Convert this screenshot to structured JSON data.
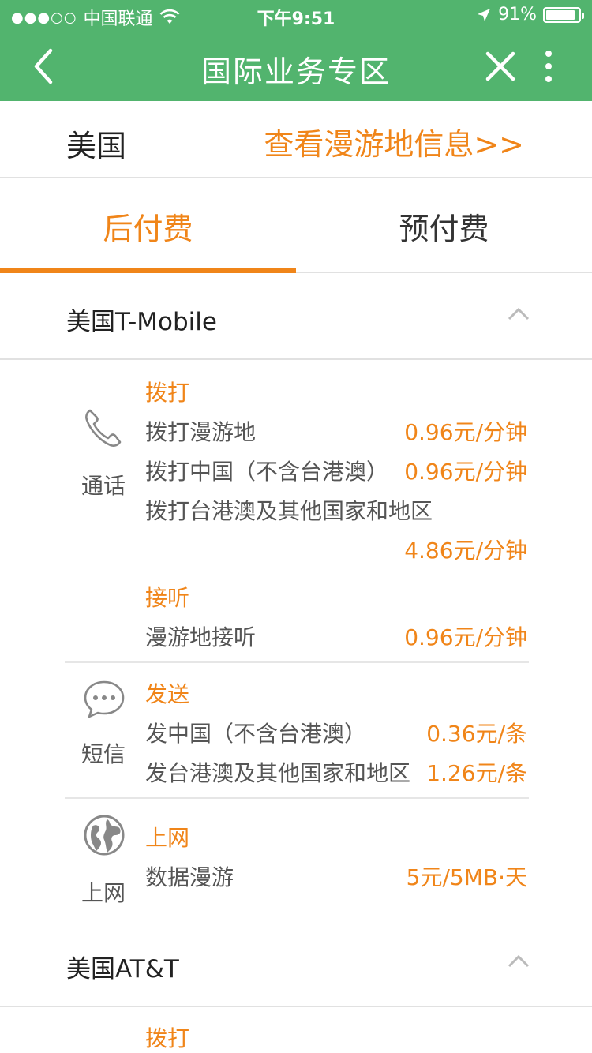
{
  "status_bar": {
    "carrier": "中国联通",
    "time": "下午9:51",
    "battery": "91%",
    "battery_level": 0.91
  },
  "navbar": {
    "title": "国际业务专区"
  },
  "country": {
    "name": "美国",
    "roam_link": "查看漫游地信息>>"
  },
  "tabs": [
    {
      "label": "后付费",
      "active": true
    },
    {
      "label": "预付费",
      "active": false
    }
  ],
  "operators": [
    {
      "name": "美国T-Mobile",
      "sections": [
        {
          "label": "通话",
          "icon": "phone-icon",
          "groups": [
            {
              "title": "拨打",
              "items": [
                {
                  "label": "拨打漫游地",
                  "price": "0.96元/分钟"
                },
                {
                  "label": "拨打中国（不含台港澳）",
                  "price": "0.96元/分钟"
                },
                {
                  "label": "拨打台港澳及其他国家和地区",
                  "price": "4.86元/分钟"
                }
              ]
            },
            {
              "title": "接听",
              "items": [
                {
                  "label": "漫游地接听",
                  "price": "0.96元/分钟"
                }
              ]
            }
          ]
        },
        {
          "label": "短信",
          "icon": "message-icon",
          "groups": [
            {
              "title": "发送",
              "items": [
                {
                  "label": "发中国（不含台港澳）",
                  "price": "0.36元/条"
                },
                {
                  "label": "发台港澳及其他国家和地区",
                  "price": "1.26元/条"
                }
              ]
            }
          ]
        },
        {
          "label": "上网",
          "icon": "globe-icon",
          "groups": [
            {
              "title": "上网",
              "items": [
                {
                  "label": "数据漫游",
                  "price": "5元/5MB·天"
                }
              ]
            }
          ]
        }
      ]
    },
    {
      "name": "美国AT&T",
      "sections": [
        {
          "groups": [
            {
              "title": "拨打"
            }
          ]
        }
      ]
    }
  ]
}
